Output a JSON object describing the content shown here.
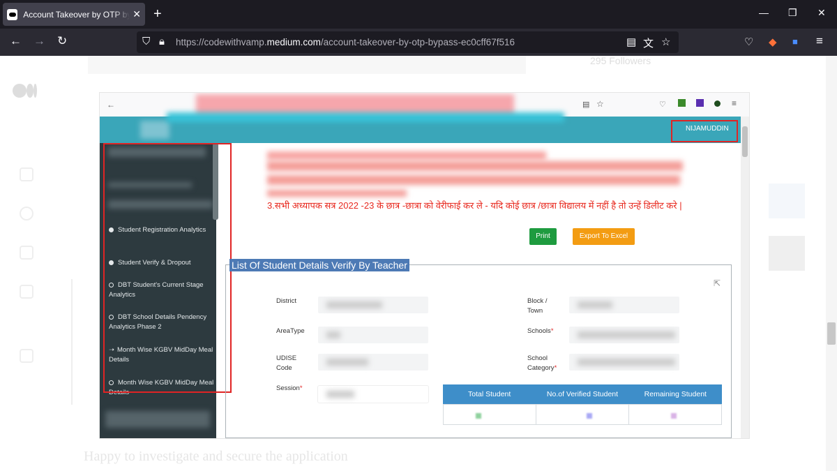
{
  "browser": {
    "tab_title": "Account Takeover by OTP bypass",
    "tab_close": "✕",
    "new_tab": "+",
    "url_prefix": "https://codewithvamp.",
    "url_domain": "medium.com",
    "url_path": "/account-takeover-by-otp-bypass-ec0cff67f516"
  },
  "page": {
    "followers_text": "295 Followers",
    "bottom_text": "Happy to investigate and secure the application"
  },
  "screenshot": {
    "user_name": "NIJAMUDDIN",
    "sidebar_items": [
      {
        "label": "Student Registration Analytics",
        "marker": "dot"
      },
      {
        "label": "Student Verify & Dropout",
        "marker": "dot"
      },
      {
        "label": "DBT Student's Current Stage Analytics",
        "marker": "ring"
      },
      {
        "label": "DBT School Details Pendency Analytics Phase 2",
        "marker": "ring"
      },
      {
        "label": "Month Wise KGBV MidDay Meal Details",
        "marker": "arrow"
      },
      {
        "label": "Month Wise KGBV MidDay Meal Details",
        "marker": "ring"
      }
    ],
    "notice_line": "3.सभी अध्यापक सत्र 2022 -23 के छात्र -छात्रा को वेरीफाई कर ले - यदि कोई छात्र /छात्रा विद्यालय में नहीं है तो उन्हें डिलीट करे |",
    "print_label": "Print",
    "export_label": "Export To Excel",
    "panel_title": "List Of Student Details Verify By Teacher",
    "labels": {
      "district": "District",
      "area_type": "AreaType",
      "udise_code": "UDISE Code",
      "session": "Session",
      "block_town": "Block / Town",
      "schools": "Schools",
      "school_category": "School Category"
    },
    "stats_headers": [
      "Total Student",
      "No.of Verified Student",
      "Remaining Student"
    ]
  }
}
